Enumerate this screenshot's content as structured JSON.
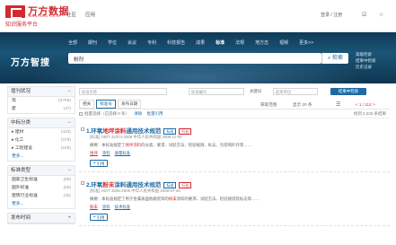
{
  "header": {
    "brand": "万方数据",
    "brand_en": "WANFANG DATA",
    "subtitle": "知识服务平台",
    "nav": [
      "社区",
      "应用"
    ],
    "login": "登录 / 注册",
    "icon_a": "☑",
    "icon_b": "☆"
  },
  "hero": {
    "nav": [
      "全部",
      "期刊",
      "学位",
      "会议",
      "专利",
      "科技报告",
      "成果",
      "标准",
      "法规",
      "地方志",
      "视频",
      "更多>>"
    ],
    "active_nav": "标准",
    "title": "万方智搜",
    "query": "粉剂",
    "search_label": "检索",
    "links": [
      "高级检索",
      "结果中检索",
      "历史记录"
    ]
  },
  "sidebar": {
    "panels": [
      {
        "title": "增刊状况",
        "toggle": "−",
        "rows": [
          {
            "label": "现",
            "count": "(2768)"
          },
          {
            "label": "废",
            "count": "(47)"
          }
        ]
      },
      {
        "title": "中标分类",
        "toggle": "−",
        "rows": [
          {
            "label": "▸ 建材",
            "count": "(423)"
          },
          {
            "label": "▸ 化工",
            "count": "(378)"
          },
          {
            "label": "▸ 工程建设",
            "count": "(226)"
          },
          {
            "label": "更多...",
            "count": ""
          }
        ]
      },
      {
        "title": "标准类型",
        "toggle": "−",
        "rows": [
          {
            "label": "国家卫生标准",
            "count": "(65)"
          },
          {
            "label": "国外标准",
            "count": "(58)"
          },
          {
            "label": "建筑行业标准",
            "count": "(46)"
          },
          {
            "label": "更多...",
            "count": ""
          }
        ]
      },
      {
        "title": "发布时间",
        "toggle": "+",
        "rows": []
      }
    ]
  },
  "main": {
    "filters": {
      "title_placeholder": "标准名称",
      "number_placeholder": "标准编号",
      "keyword_placeholder": "关键词",
      "agency_placeholder": "起草单位",
      "search_in_results": "结果中检索"
    },
    "toolbar": {
      "tabs": [
        "相关",
        "标准号",
        "发布日期"
      ],
      "active_tab": "标准号",
      "fetch_label": "获取范围",
      "per_page": "显示 20 条",
      "page": "< 1 / 112 >",
      "total": "找到 2,233 条结果"
    },
    "selbar": {
      "selected": "批量选择（已选择 0 条）",
      "clear": "清除",
      "export": "批量引用"
    },
    "results": [
      {
        "index": "1.",
        "title_pre": "环氧",
        "title_hl": "地坪涂料",
        "title_post": "通用技术规范",
        "badge": "标准",
        "badge2": "行业",
        "meta": "[标准]  GB/T 22374-2008  中华人民共和国  2008-11-04",
        "desc_pre": "摘要：本标准规定了",
        "desc_hl": "地坪涂料",
        "desc_post": "的分类、要求、试验方法、检验规则、标志、包装和贮存等……",
        "keywords": [
          "地坪",
          "涂料",
          "质量标准"
        ],
        "cite": "引用"
      },
      {
        "index": "2.",
        "title_pre": "环氧",
        "title_hl": "粉末",
        "title_post": "涂料通用技术规范",
        "badge": "标准",
        "badge2": "行业",
        "meta": "[标准]  HG/T 2006-2006  中华人民共和国  2006-07-26",
        "desc_pre": "摘要：本标准规定了用于金属表面防腐装饰的",
        "desc_hl": "粉末",
        "desc_post": "涂料的要求、试验方法、检验规则及标志等……",
        "keywords": [
          "粉末",
          "涂料",
          "技术标准"
        ],
        "cite": "引用"
      }
    ]
  },
  "colors": {
    "brand_red": "#d22a2e",
    "link_blue": "#1d6aa5",
    "hero_blue": "#0f3a58"
  }
}
